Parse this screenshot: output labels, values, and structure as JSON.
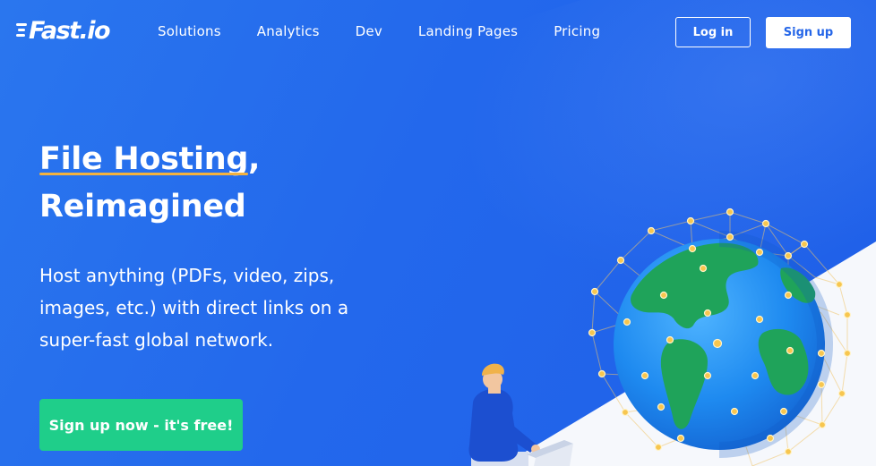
{
  "brand": {
    "name": "Fast.io"
  },
  "nav": {
    "links": [
      "Solutions",
      "Analytics",
      "Dev",
      "Landing Pages",
      "Pricing"
    ],
    "login_label": "Log in",
    "signup_label": "Sign up"
  },
  "hero": {
    "title_highlight": "File Hosting",
    "title_comma": ",",
    "title_line2": "Reimagined",
    "description": "Host anything (PDFs, video, zips, images, etc.) with direct links on a super-fast global network.",
    "cta_label": "Sign up now - it's free!"
  },
  "colors": {
    "background": "#2368ec",
    "accent_underline": "#f3b23f",
    "cta": "#1fce8a",
    "globe_ocean": "#1e8af0",
    "globe_land": "#1fa35a",
    "network_node": "#f7c64f"
  },
  "icons": {
    "logo": "speed-lines-logo-icon",
    "illustration": "globe-network-illustration"
  }
}
